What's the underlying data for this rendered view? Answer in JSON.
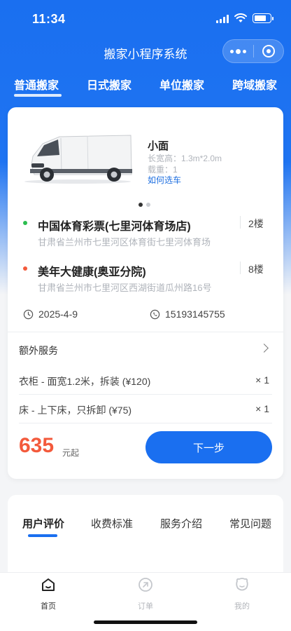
{
  "status_bar": {
    "time": "11:34",
    "battery_level": 0.75
  },
  "nav": {
    "title": "搬家小程序系统"
  },
  "category_tabs": [
    {
      "label": "普通搬家",
      "active": true
    },
    {
      "label": "日式搬家",
      "active": false
    },
    {
      "label": "单位搬家",
      "active": false
    },
    {
      "label": "跨域搬家",
      "active": false
    }
  ],
  "vehicle": {
    "name": "小面",
    "dimensions": "长宽高：1.3m*2.0m",
    "load": "载重：1",
    "choose_link": "如何选车",
    "carousel_pages": 2,
    "carousel_active": 1
  },
  "route": {
    "origin": {
      "name": "中国体育彩票(七里河体育场店)",
      "detail": "甘肃省兰州市七里河区体育街七里河体育场",
      "floor": "2楼",
      "dot_color": "#2bbd4f"
    },
    "destination": {
      "name": "美年大健康(奥亚分院)",
      "detail": "甘肃省兰州市七里河区西湖街道瓜州路16号",
      "floor": "8楼",
      "dot_color": "#f35a3c"
    }
  },
  "order_meta": {
    "date": "2025-4-9",
    "phone": "15193145755"
  },
  "extra_services": {
    "label": "额外服务",
    "items": [
      {
        "name": "衣柜 - 面宽1.2米，拆装 (¥120)",
        "qty": "× 1"
      },
      {
        "name": "床 - 上下床，只拆卸 (¥75)",
        "qty": "× 1"
      }
    ]
  },
  "pricing": {
    "amount": "635",
    "unit": "元起",
    "next_label": "下一步"
  },
  "info_tabs": [
    {
      "label": "用户评价",
      "active": true
    },
    {
      "label": "收费标准",
      "active": false
    },
    {
      "label": "服务介绍",
      "active": false
    },
    {
      "label": "常见问题",
      "active": false
    }
  ],
  "tabbar": [
    {
      "label": "首页",
      "icon": "home-icon",
      "active": true
    },
    {
      "label": "订单",
      "icon": "order-icon",
      "active": false
    },
    {
      "label": "我的",
      "icon": "profile-icon",
      "active": false
    }
  ],
  "colors": {
    "primary": "#1a6ff0",
    "price": "#f35a3c",
    "origin_dot": "#2bbd4f"
  }
}
